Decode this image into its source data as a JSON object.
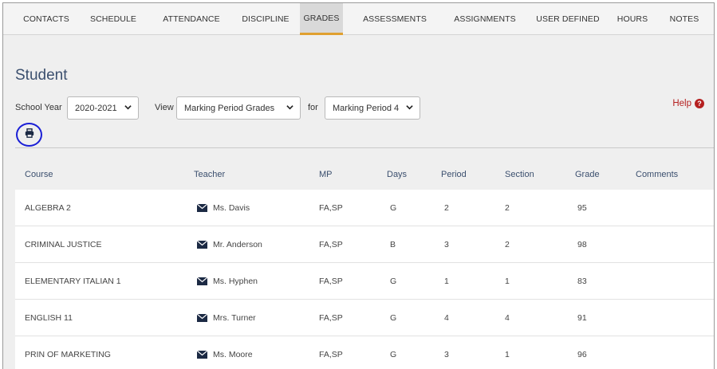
{
  "tabs": [
    "CONTACTS",
    "SCHEDULE",
    "ATTENDANCE",
    "DISCIPLINE",
    "GRADES",
    "ASSESSMENTS",
    "ASSIGNMENTS",
    "USER DEFINED",
    "HOURS",
    "NOTES"
  ],
  "active_tab": "GRADES",
  "page_title": "Student",
  "filters": {
    "school_year_label": "School Year",
    "school_year_value": "2020-2021",
    "view_label": "View",
    "view_value": "Marking Period Grades",
    "for_label": "for",
    "for_value": "Marking Period 4"
  },
  "help_label": "Help",
  "table": {
    "headers": [
      "Course",
      "Teacher",
      "MP",
      "Days",
      "Period",
      "Section",
      "Grade",
      "Comments"
    ],
    "rows": [
      {
        "course": "ALGEBRA 2",
        "teacher": "Ms. Davis",
        "mp": "FA,SP",
        "days": "G",
        "period": "2",
        "section": "2",
        "grade": "95",
        "comments": ""
      },
      {
        "course": "CRIMINAL JUSTICE",
        "teacher": "Mr. Anderson",
        "mp": "FA,SP",
        "days": "B",
        "period": "3",
        "section": "2",
        "grade": "98",
        "comments": ""
      },
      {
        "course": "ELEMENTARY ITALIAN 1",
        "teacher": "Ms. Hyphen",
        "mp": "FA,SP",
        "days": "G",
        "period": "1",
        "section": "1",
        "grade": "83",
        "comments": ""
      },
      {
        "course": "ENGLISH 11",
        "teacher": "Mrs. Turner",
        "mp": "FA,SP",
        "days": "G",
        "period": "4",
        "section": "4",
        "grade": "91",
        "comments": ""
      },
      {
        "course": "PRIN OF MARKETING",
        "teacher": "Ms. Moore",
        "mp": "FA,SP",
        "days": "G",
        "period": "3",
        "section": "1",
        "grade": "96",
        "comments": ""
      }
    ]
  },
  "icons": {
    "print": "print-icon",
    "mail": "mail-icon",
    "help": "question-circle-icon",
    "caret": "chevron-down-icon"
  },
  "colors": {
    "accent_tab_underline": "#e0a030",
    "heading_blue": "#3b4f6e",
    "help_red": "#b52020",
    "highlight_circle": "#1a1fd6"
  }
}
